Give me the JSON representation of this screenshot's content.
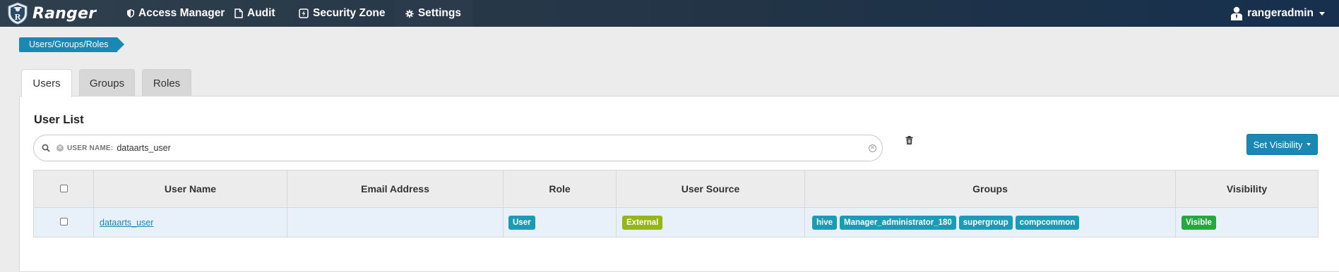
{
  "app": {
    "brand": "Ranger"
  },
  "nav": {
    "items": [
      {
        "label": "Access Manager",
        "icon": "shield-icon"
      },
      {
        "label": "Audit",
        "icon": "file-icon"
      },
      {
        "label": "Security Zone",
        "icon": "bolt-square-icon"
      },
      {
        "label": "Settings",
        "icon": "gear-icon"
      }
    ],
    "active": "Settings",
    "user": "rangeradmin"
  },
  "breadcrumb": "Users/Groups/Roles",
  "tabs": [
    {
      "label": "Users"
    },
    {
      "label": "Groups"
    },
    {
      "label": "Roles"
    }
  ],
  "active_tab": "Users",
  "panel": {
    "title": "User List"
  },
  "search": {
    "facet_label": "USER NAME:",
    "facet_value": "dataarts_user"
  },
  "buttons": {
    "set_visibility": "Set Visibility"
  },
  "table": {
    "columns": [
      "",
      "User Name",
      "Email Address",
      "Role",
      "User Source",
      "Groups",
      "Visibility"
    ],
    "rows": [
      {
        "user_name": "dataarts_user",
        "email": "",
        "role": "User",
        "user_source": "External",
        "groups": [
          "hive",
          "Manager_administrator_180",
          "supergroup",
          "compcommon"
        ],
        "visibility": "Visible"
      }
    ]
  },
  "colors": {
    "accent": "#1b88b4",
    "label_info": "#1a9cb6",
    "label_warning": "#94b616",
    "label_success": "#25a83d"
  }
}
